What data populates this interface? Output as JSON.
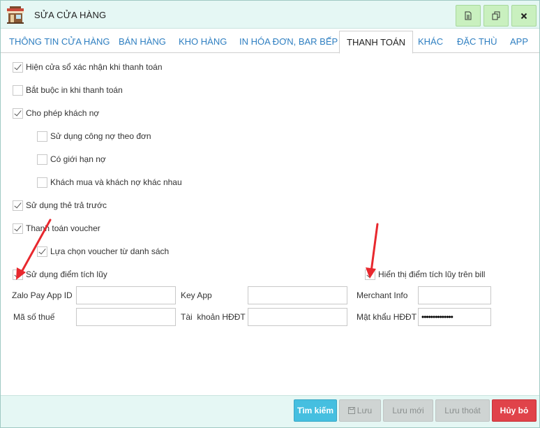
{
  "window": {
    "title": "SỬA CỬA HÀNG"
  },
  "tabs": [
    {
      "label": "THÔNG TIN CỬA HÀNG"
    },
    {
      "label": "BÁN HÀNG"
    },
    {
      "label": "KHO HÀNG"
    },
    {
      "label": "IN HÓA ĐƠN, BAR BẾP"
    },
    {
      "label": "THANH TOÁN",
      "active": true
    },
    {
      "label": "KHÁC"
    },
    {
      "label": "ĐẶC THÙ"
    },
    {
      "label": "APP"
    }
  ],
  "options": [
    {
      "label": "Hiện cửa sổ xác nhận khi thanh toán",
      "checked": true
    },
    {
      "label": "Bắt buộc in khi thanh toán",
      "checked": false
    },
    {
      "label": "Cho phép khách nợ",
      "checked": true
    },
    {
      "label": "Sử dụng công nợ theo đơn",
      "checked": false
    },
    {
      "label": "Có giới hạn nợ",
      "checked": false
    },
    {
      "label": "Khách mua và khách nợ khác nhau",
      "checked": false
    },
    {
      "label": "Sử dụng thẻ trả trước",
      "checked": true
    },
    {
      "label": "Thanh toán voucher",
      "checked": true
    },
    {
      "label": "Lựa chọn voucher từ danh sách",
      "checked": true
    },
    {
      "label": "Sử dụng điểm tích lũy",
      "checked": true
    },
    {
      "label": "Hiển thị điểm tích lũy trên bill",
      "checked": true
    }
  ],
  "fields": {
    "zalo_pay_app_id": {
      "label": "Zalo Pay App ID",
      "value": ""
    },
    "key_app": {
      "label": "Key App",
      "value": ""
    },
    "merchant_info": {
      "label": "Merchant Info",
      "value": ""
    },
    "tax_code": {
      "label": "Mã số thuế",
      "value": ""
    },
    "hddt_account": {
      "label": "Tài  khoản HĐĐT",
      "value": ""
    },
    "hddt_password": {
      "label": "Mật khẩu HĐĐT",
      "value": "••••••••••••••"
    }
  },
  "footer": {
    "search": "Tìm kiếm",
    "save": "Lưu",
    "save_new": "Lưu mới",
    "save_exit": "Lưu thoát",
    "cancel": "Hủy bỏ"
  },
  "colors": {
    "titlebar_bg": "#e5f7f4",
    "title_button_bg": "#c9f0bf",
    "tab_link": "#2f7fc1",
    "search_button": "#45bfe0",
    "cancel_button": "#e0434a",
    "annotation_arrow": "#e8282e"
  },
  "icons": {
    "app": "store-icon",
    "title_buttons": [
      "document-icon",
      "copy-icon",
      "close-icon"
    ],
    "save": "floppy-disk-icon"
  }
}
